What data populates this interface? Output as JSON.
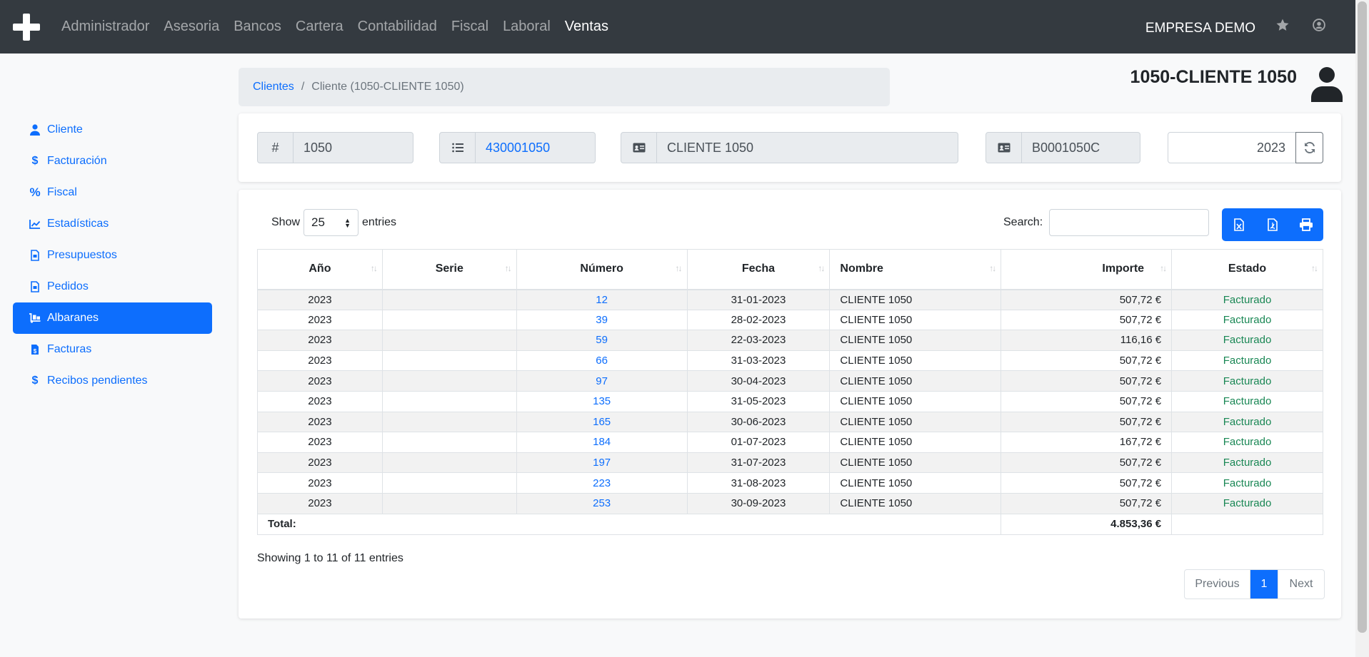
{
  "navbar": {
    "items": [
      "Administrador",
      "Asesoria",
      "Bancos",
      "Cartera",
      "Contabilidad",
      "Fiscal",
      "Laboral",
      "Ventas"
    ],
    "active_item": "Ventas",
    "company": "EMPRESA DEMO",
    "icons": [
      "plus-logo-icon",
      "star-icon",
      "user-circle-icon"
    ]
  },
  "sidebar": {
    "items": [
      {
        "label": "Cliente",
        "icon": "user-icon"
      },
      {
        "label": "Facturación",
        "icon": "dollar-icon"
      },
      {
        "label": "Fiscal",
        "icon": "percent-icon"
      },
      {
        "label": "Estadísticas",
        "icon": "chart-line-icon"
      },
      {
        "label": "Presupuestos",
        "icon": "file-invoice-icon"
      },
      {
        "label": "Pedidos",
        "icon": "file-invoice-icon"
      },
      {
        "label": "Albaranes",
        "icon": "dolly-icon",
        "active": true
      },
      {
        "label": "Facturas",
        "icon": "file-invoice-dollar-icon"
      },
      {
        "label": "Recibos pendientes",
        "icon": "dollar-icon"
      }
    ]
  },
  "breadcrumb": {
    "link": "Clientes",
    "separator": "/",
    "current": "Cliente (1050-CLIENTE 1050)"
  },
  "page_title": "1050-CLIENTE 1050",
  "header": {
    "id_prefix": "#",
    "id_value": "1050",
    "account_value": "430001050",
    "name_value": "CLIENTE 1050",
    "tax_id_value": "B0001050C",
    "year_value": "2023"
  },
  "table_controls": {
    "show_label": "Show",
    "entries_label": "entries",
    "length_value": "25",
    "search_label": "Search:",
    "search_value": "",
    "export_buttons": [
      "excel-icon",
      "pdf-icon",
      "print-icon"
    ]
  },
  "table": {
    "columns": [
      "Año",
      "Serie",
      "Número",
      "Fecha",
      "Nombre",
      "Importe",
      "Estado"
    ],
    "rows": [
      {
        "year": "2023",
        "serie": "",
        "numero": "12",
        "fecha": "31-01-2023",
        "nombre": "CLIENTE 1050",
        "importe": "507,72 €",
        "estado": "Facturado"
      },
      {
        "year": "2023",
        "serie": "",
        "numero": "39",
        "fecha": "28-02-2023",
        "nombre": "CLIENTE 1050",
        "importe": "507,72 €",
        "estado": "Facturado"
      },
      {
        "year": "2023",
        "serie": "",
        "numero": "59",
        "fecha": "22-03-2023",
        "nombre": "CLIENTE 1050",
        "importe": "116,16 €",
        "estado": "Facturado"
      },
      {
        "year": "2023",
        "serie": "",
        "numero": "66",
        "fecha": "31-03-2023",
        "nombre": "CLIENTE 1050",
        "importe": "507,72 €",
        "estado": "Facturado"
      },
      {
        "year": "2023",
        "serie": "",
        "numero": "97",
        "fecha": "30-04-2023",
        "nombre": "CLIENTE 1050",
        "importe": "507,72 €",
        "estado": "Facturado"
      },
      {
        "year": "2023",
        "serie": "",
        "numero": "135",
        "fecha": "31-05-2023",
        "nombre": "CLIENTE 1050",
        "importe": "507,72 €",
        "estado": "Facturado"
      },
      {
        "year": "2023",
        "serie": "",
        "numero": "165",
        "fecha": "30-06-2023",
        "nombre": "CLIENTE 1050",
        "importe": "507,72 €",
        "estado": "Facturado"
      },
      {
        "year": "2023",
        "serie": "",
        "numero": "184",
        "fecha": "01-07-2023",
        "nombre": "CLIENTE 1050",
        "importe": "167,72 €",
        "estado": "Facturado"
      },
      {
        "year": "2023",
        "serie": "",
        "numero": "197",
        "fecha": "31-07-2023",
        "nombre": "CLIENTE 1050",
        "importe": "507,72 €",
        "estado": "Facturado"
      },
      {
        "year": "2023",
        "serie": "",
        "numero": "223",
        "fecha": "31-08-2023",
        "nombre": "CLIENTE 1050",
        "importe": "507,72 €",
        "estado": "Facturado"
      },
      {
        "year": "2023",
        "serie": "",
        "numero": "253",
        "fecha": "30-09-2023",
        "nombre": "CLIENTE 1050",
        "importe": "507,72 €",
        "estado": "Facturado"
      }
    ],
    "total_label": "Total:",
    "total_value": "4.853,36 €"
  },
  "footer": {
    "info": "Showing 1 to 11 of 11 entries",
    "previous": "Previous",
    "current_page": "1",
    "next": "Next"
  },
  "colors": {
    "navbar_bg": "#343a40",
    "primary": "#0d6efd",
    "status_green": "#198754"
  }
}
